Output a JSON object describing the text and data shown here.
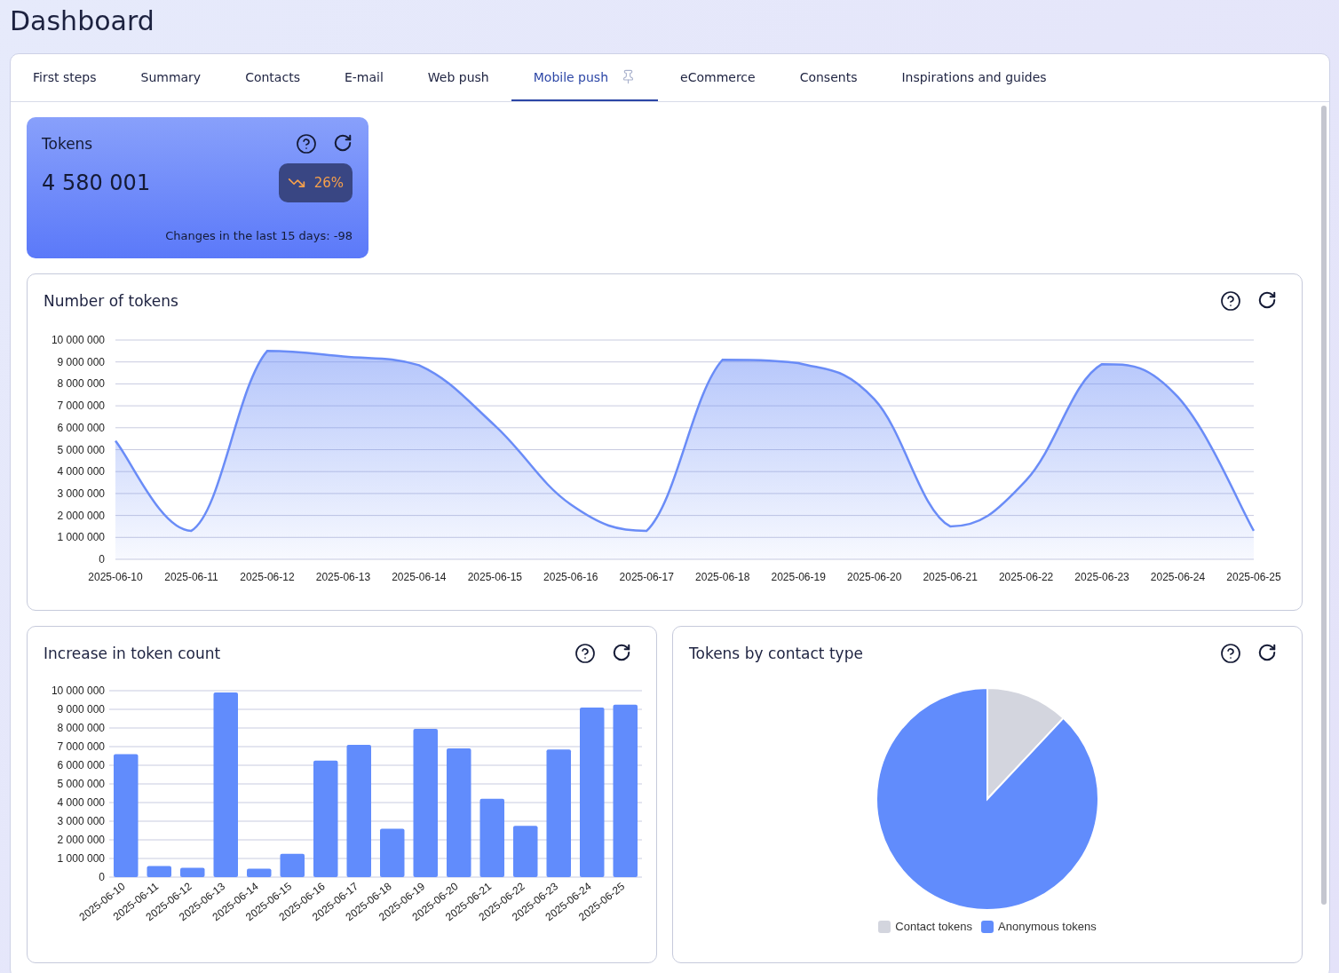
{
  "page_title": "Dashboard",
  "tabs": [
    {
      "label": "First steps",
      "selected": false
    },
    {
      "label": "Summary",
      "selected": false
    },
    {
      "label": "Contacts",
      "selected": false
    },
    {
      "label": "E-mail",
      "selected": false
    },
    {
      "label": "Web push",
      "selected": false
    },
    {
      "label": "Mobile push",
      "selected": true,
      "pinned": true
    },
    {
      "label": "eCommerce",
      "selected": false
    },
    {
      "label": "Consents",
      "selected": false
    },
    {
      "label": "Inspirations and guides",
      "selected": false
    }
  ],
  "kpi": {
    "title": "Tokens",
    "value": "4 580 001",
    "trending_down": true,
    "change": "26%",
    "note": "Changes in the last 15 days: -98"
  },
  "line_card": {
    "title": "Number of tokens",
    "chart_data": {
      "type": "area",
      "categories": [
        "2025-06-10",
        "2025-06-11",
        "2025-06-12",
        "2025-06-13",
        "2025-06-14",
        "2025-06-15",
        "2025-06-16",
        "2025-06-17",
        "2025-06-18",
        "2025-06-19",
        "2025-06-20",
        "2025-06-21",
        "2025-06-22",
        "2025-06-23",
        "2025-06-24",
        "2025-06-25"
      ],
      "grid": true,
      "series": [
        {
          "color": "#6a8cf7",
          "values": [
            5400000,
            1300000,
            9500000,
            9250000,
            8850000,
            6100000,
            2500000,
            1300000,
            9100000,
            8950000,
            7300000,
            1500000,
            3600000,
            8900000,
            7400000,
            1300000
          ]
        }
      ],
      "ylim": [
        0,
        10000000
      ],
      "yticks": [
        {
          "value": 0,
          "label": "0"
        },
        {
          "value": 1000000,
          "label": "1 000 000"
        },
        {
          "value": 2000000,
          "label": "2 000 000"
        },
        {
          "value": 3000000,
          "label": "3 000 000"
        },
        {
          "value": 4000000,
          "label": "4 000 000"
        },
        {
          "value": 5000000,
          "label": "5 000 000"
        },
        {
          "value": 6000000,
          "label": "6 000 000"
        },
        {
          "value": 7000000,
          "label": "7 000 000"
        },
        {
          "value": 8000000,
          "label": "8 000 000"
        },
        {
          "value": 9000000,
          "label": "9 000 000"
        },
        {
          "value": 10000000,
          "label": "10 000 000"
        }
      ]
    }
  },
  "bar_card": {
    "title": "Increase in token count",
    "chart_data": {
      "type": "bar",
      "categories": [
        "2025-06-10",
        "2025-06-11",
        "2025-06-12",
        "2025-06-13",
        "2025-06-14",
        "2025-06-15",
        "2025-06-16",
        "2025-06-17",
        "2025-06-18",
        "2025-06-19",
        "2025-06-20",
        "2025-06-21",
        "2025-06-22",
        "2025-06-23",
        "2025-06-24",
        "2025-06-25"
      ],
      "grid": true,
      "series": [
        {
          "color": "#618cfc",
          "values": [
            6600000,
            600000,
            500000,
            9900000,
            450000,
            1250000,
            6250000,
            7100000,
            2600000,
            7950000,
            6900000,
            4200000,
            2750000,
            6850000,
            9100000,
            9250000
          ]
        }
      ],
      "ylim": [
        0,
        10000000
      ],
      "yticks": [
        {
          "value": 0,
          "label": "0"
        },
        {
          "value": 1000000,
          "label": "1 000 000"
        },
        {
          "value": 2000000,
          "label": "2 000 000"
        },
        {
          "value": 3000000,
          "label": "3 000 000"
        },
        {
          "value": 4000000,
          "label": "4 000 000"
        },
        {
          "value": 5000000,
          "label": "5 000 000"
        },
        {
          "value": 6000000,
          "label": "6 000 000"
        },
        {
          "value": 7000000,
          "label": "7 000 000"
        },
        {
          "value": 8000000,
          "label": "8 000 000"
        },
        {
          "value": 9000000,
          "label": "9 000 000"
        },
        {
          "value": 10000000,
          "label": "10 000 000"
        }
      ]
    }
  },
  "pie_card": {
    "title": "Tokens by contact type",
    "chart_data": {
      "type": "pie",
      "categories": [
        "Contact tokens",
        "Anonymous tokens"
      ],
      "series": [
        {
          "values": [
            12,
            88
          ]
        }
      ],
      "colors": [
        "#d3d5de",
        "#618cfc"
      ]
    }
  }
}
